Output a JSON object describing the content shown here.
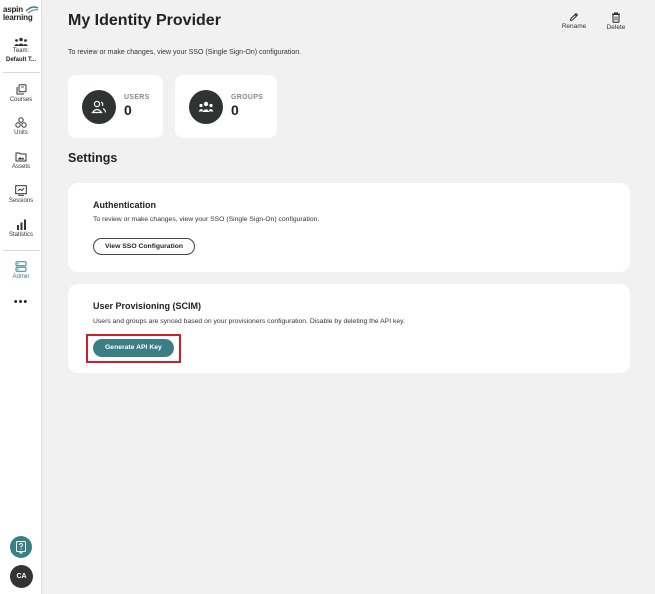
{
  "brand": {
    "logo_text_1": "aspin",
    "logo_text_2": "learning"
  },
  "team": {
    "label": "Team:",
    "name": "Default T..."
  },
  "nav": [
    {
      "label": "Courses",
      "icon": "courses-icon"
    },
    {
      "label": "Units",
      "icon": "units-icon"
    },
    {
      "label": "Assets",
      "icon": "assets-icon"
    },
    {
      "label": "Sessions",
      "icon": "sessions-icon"
    },
    {
      "label": "Statistics",
      "icon": "statistics-icon"
    },
    {
      "label": "Admin",
      "icon": "admin-icon",
      "active": true
    }
  ],
  "more_label": "•••",
  "user": {
    "initials": "CA"
  },
  "page": {
    "title": "My Identity Provider",
    "subtitle": "To review or make changes, view your SSO (Single Sign-On) configuration."
  },
  "toolbar": {
    "rename_label": "Rename",
    "delete_label": "Delete"
  },
  "stats": {
    "users": {
      "label": "USERS",
      "value": "0"
    },
    "groups": {
      "label": "GROUPS",
      "value": "0"
    }
  },
  "settings": {
    "heading": "Settings",
    "authentication": {
      "title": "Authentication",
      "description": "To review or make changes, view your SSO (Single Sign-On) configuration.",
      "button_label": "View SSO Configuration"
    },
    "provisioning": {
      "title": "User Provisioning (SCIM)",
      "description": "Users and groups are synced based on your provisioners configuration. Disable by deleting the API key.",
      "button_label": "Generate API Key"
    }
  },
  "colors": {
    "accent": "#3a7f86",
    "highlight": "#cc1f2a",
    "stat_circle": "#2f3432"
  }
}
